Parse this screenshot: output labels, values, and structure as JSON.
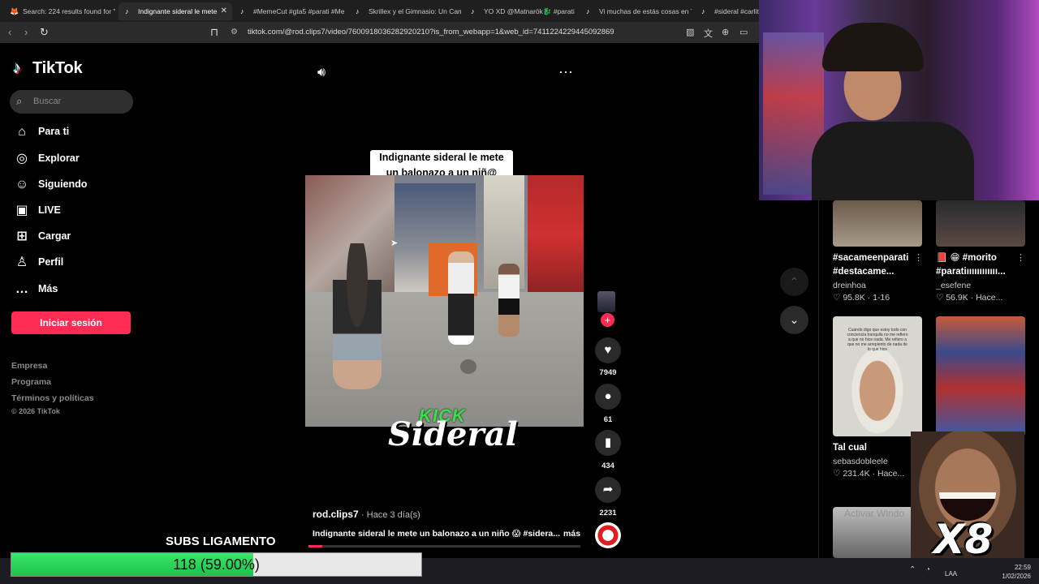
{
  "browser": {
    "tabs": [
      {
        "label": "Search: 224 results found for \"ɡ",
        "icon": "🦊"
      },
      {
        "label": "Indignante sideral le mete",
        "icon": "♪",
        "active": true
      },
      {
        "label": "#MemeCut #gta5 #parati #Me",
        "icon": "♪"
      },
      {
        "label": "Skrillex y el Gimnasio: Un Cami",
        "icon": "♪"
      },
      {
        "label": "YO XD @Matnarök🐉 #parati",
        "icon": "♪"
      },
      {
        "label": "Vi muchas de estás cosas en T",
        "icon": "♪"
      },
      {
        "label": "#sideral #carlito",
        "icon": "♪"
      }
    ],
    "url": "tiktok.com/@rod.clips7/video/7600918036282920210?is_from_webapp=1&web_id=7411224229445092869"
  },
  "sidebar": {
    "logo": "TikTok",
    "search_placeholder": "Buscar",
    "items": [
      {
        "label": "Para ti",
        "icon": "⌂"
      },
      {
        "label": "Explorar",
        "icon": "◎"
      },
      {
        "label": "Siguiendo",
        "icon": "☺"
      },
      {
        "label": "LIVE",
        "icon": "▣"
      },
      {
        "label": "Cargar",
        "icon": "⊞"
      },
      {
        "label": "Perfil",
        "icon": "♙"
      },
      {
        "label": "Más",
        "icon": "…"
      }
    ],
    "login": "Iniciar sesión",
    "footer": [
      "Empresa",
      "Programa",
      "Términos y políticas"
    ],
    "copyright": "© 2026 TikTok"
  },
  "video": {
    "caption_overlay_line1": "Indignante sideral le mete",
    "caption_overlay_line2": "un balonazo a un niñ@",
    "logo_top": "KICK",
    "logo_bottom": "Sideral",
    "likes": "7949",
    "comments": "61",
    "saves": "434",
    "shares": "2231",
    "author": "rod.clips7",
    "time": "Hace 3 día(s)",
    "description": "Indignante sideral le mete un balonazo a un niño 😱 #sidera...",
    "more": "más",
    "progress": 0.05
  },
  "related": [
    {
      "title1": "#sacameenparati",
      "title2": "#destacame...",
      "user": "dreinhoa",
      "stats": "♡ 95.8K · 1-16"
    },
    {
      "title1": "📕 😁 #morito",
      "title2": "#paratiıııııııııııı...",
      "user": "_esefene",
      "stats": "♡ 56.9K · Hace..."
    },
    {
      "title1": "Tal cual",
      "title2": "",
      "user": "sebasdobleele",
      "stats": "♡ 231.4K · Hace..."
    }
  ],
  "thumb_text": "Cuando digo que estoy todo con conciencia tranquila no me refiero a que no hice nada. Me refiero a que no me arrepiento de nada de lo que hice",
  "overlay": {
    "subs_label": "SUBS LIGAMENTO",
    "subs_value": "118 (59.00%)",
    "subs_fraction": 0.59,
    "multiplier": "X8",
    "watermark": "Activar Windo"
  },
  "taskbar": {
    "lang": "LAA",
    "time": "22:59",
    "date": "1/02/2026"
  }
}
